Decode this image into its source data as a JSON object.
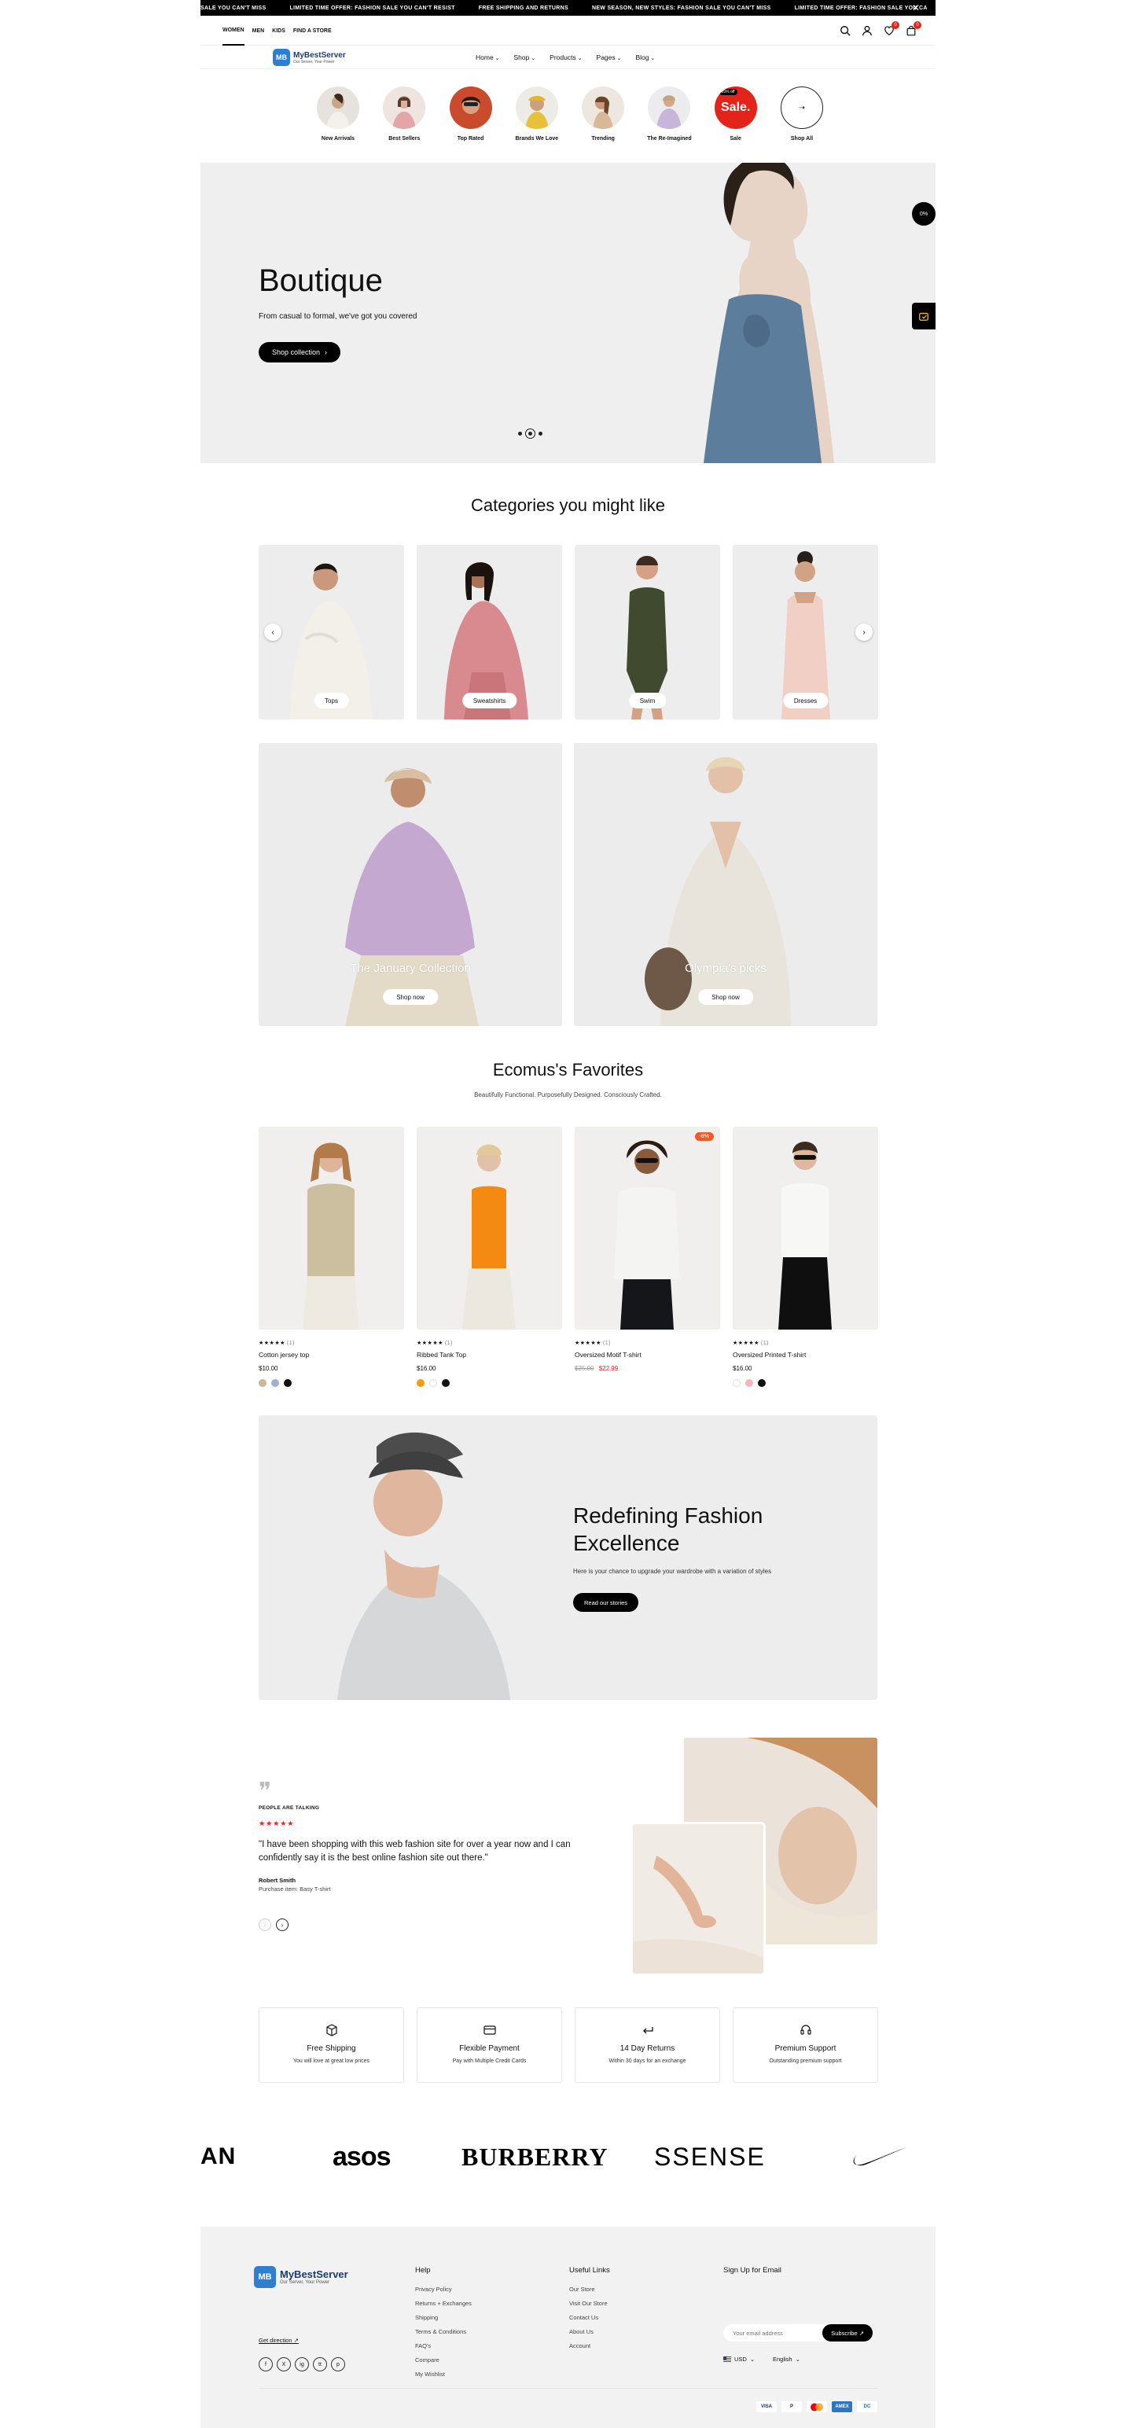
{
  "announcement": {
    "items": [
      "SALE YOU CAN'T MISS",
      "LIMITED TIME OFFER: FASHION SALE YOU CAN'T RESIST",
      "FREE SHIPPING AND RETURNS",
      "NEW SEASON, NEW STYLES: FASHION SALE YOU CAN'T MISS",
      "LIMITED TIME OFFER: FASHION SALE YOU CA"
    ],
    "close_icon": "close-icon"
  },
  "topnav": {
    "tabs": [
      "WOMEN",
      "MEN",
      "KIDS",
      "FIND A STORE"
    ],
    "active_tab": "WOMEN",
    "wishlist_count": "0",
    "cart_count": "0"
  },
  "header": {
    "logo_mark": "MB",
    "logo_name": "MyBestServer",
    "logo_tagline": "Our Server, Your Power",
    "menu": [
      "Home",
      "Shop",
      "Products",
      "Pages",
      "Blog"
    ]
  },
  "circles": {
    "items": [
      "New Arrivals",
      "Best Sellers",
      "Top Rated",
      "Brands We Love",
      "Trending",
      "The Re-Imagined",
      "Sale",
      "Shop All"
    ],
    "sale_text": "Sale.",
    "sale_tag": "20% off",
    "shop_all_icon": "arrow-right-icon"
  },
  "hero": {
    "title": "Boutique",
    "subtitle": "From casual to formal, we've got you covered",
    "button": "Shop collection",
    "slides": 3,
    "active_slide": 2,
    "side_pill": "0%"
  },
  "categories": {
    "title": "Categories you might like",
    "items": [
      "Tops",
      "Sweatshirts",
      "Swim",
      "Dresses"
    ]
  },
  "collections": [
    {
      "title": "The January Collection",
      "button": "Shop now"
    },
    {
      "title": "Olympia's picks",
      "button": "Shop now"
    }
  ],
  "favorites": {
    "title": "Ecomus's Favorites",
    "subtitle": "Beautifully Functional. Purposefully Designed. Consciously Crafted.",
    "products": [
      {
        "name": "Cotton jersey top",
        "price": "$10.00",
        "old_price": "",
        "rating_count": "(1)",
        "badge": "",
        "swatches": [
          "#c8b79a",
          "#9fb3c8",
          "#111111"
        ]
      },
      {
        "name": "Ribbed Tank Top",
        "price": "$16.00",
        "old_price": "",
        "rating_count": "(1)",
        "badge": "",
        "swatches": [
          "#f39c12",
          "#ffffff",
          "#111111"
        ]
      },
      {
        "name": "Oversized Motif T-shirt",
        "price": "$22.99",
        "old_price": "$25.00",
        "rating_count": "(1)",
        "badge": "-8%",
        "swatches": []
      },
      {
        "name": "Oversized Printed T-shirt",
        "price": "$16.00",
        "old_price": "",
        "rating_count": "(1)",
        "badge": "",
        "swatches": [
          "#ffffff",
          "#f4b6c2",
          "#111111"
        ]
      }
    ]
  },
  "banner": {
    "title": "Redefining Fashion Excellence",
    "subtitle": "Here is your chance to upgrade your wardrobe with a variation of styles",
    "button": "Read our stories"
  },
  "testimonial": {
    "label": "PEOPLE ARE TALKING",
    "text": "\"I have been shopping with this web fashion site for over a year now and I can confidently say it is the best online fashion site out there.\"",
    "author": "Robert Smith",
    "purchase": "Purchase item: Basy T-shirt",
    "rating": 5
  },
  "features": [
    {
      "icon": "box-icon",
      "title": "Free Shipping",
      "desc": "You will love at great low prices"
    },
    {
      "icon": "credit-card-icon",
      "title": "Flexible Payment",
      "desc": "Pay with Multiple Credit Cards"
    },
    {
      "icon": "return-arrow-icon",
      "title": "14 Day Returns",
      "desc": "Within 30 days for an exchange"
    },
    {
      "icon": "headset-icon",
      "title": "Premium Support",
      "desc": "Outstanding premium support"
    }
  ],
  "brands": [
    "AN",
    "asos",
    "BURBERRY",
    "SSENSE",
    "nike-swoosh-logo"
  ],
  "footer": {
    "logo_name": "MyBestServer",
    "logo_tagline": "Our Server, Your Power",
    "get_direction": "Get direction",
    "socials": [
      "f",
      "X",
      "ig",
      "tt",
      "p"
    ],
    "help_title": "Help",
    "help_links": [
      "Privacy Policy",
      "Returns + Exchanges",
      "Shipping",
      "Terms & Conditions",
      "FAQ's",
      "Compare",
      "My Wishlist"
    ],
    "useful_title": "Useful Links",
    "useful_links": [
      "Our Store",
      "Visit Our Store",
      "Contact Us",
      "About Us",
      "Account"
    ],
    "signup_title": "Sign Up for Email",
    "email_placeholder": "Your email address",
    "subscribe": "Subscribe",
    "currency": "USD",
    "language": "English",
    "payments": [
      "VISA",
      "P",
      "MC",
      "AMEX",
      "DC"
    ]
  },
  "colors": {
    "accent_red": "#e2241b",
    "sale_badge": "#f05a28",
    "logo_blue": "#2f7fd0",
    "black": "#000000"
  }
}
